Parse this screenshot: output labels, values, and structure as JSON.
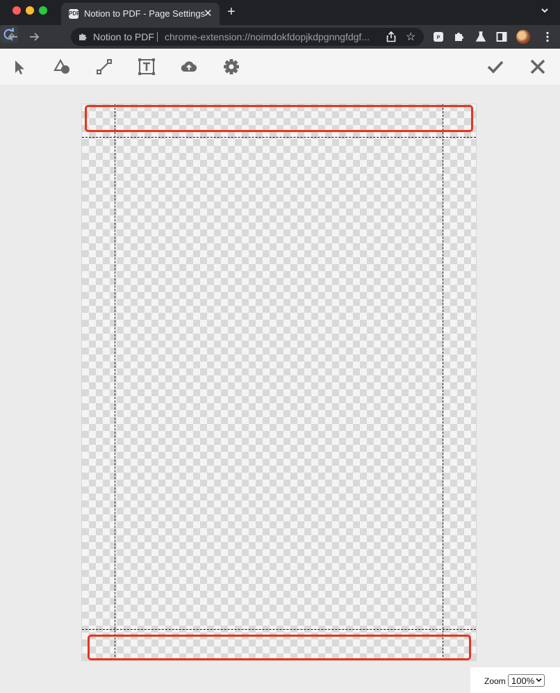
{
  "browser": {
    "tab": {
      "title": "Notion to PDF - Page Settings",
      "favicon": "pdf-favicon-icon",
      "favicon_text": "PDF"
    },
    "omnibox": {
      "extension_name": "Notion to PDF",
      "url": "chrome-extension://noimdokfdopjkdpgnngfdgf..."
    }
  },
  "editor": {
    "tools": [
      {
        "name": "select-tool",
        "icon": "cursor-arrow-icon"
      },
      {
        "name": "shape-tool",
        "icon": "shapes-icon"
      },
      {
        "name": "line-tool",
        "icon": "line-icon"
      },
      {
        "name": "text-tool",
        "icon": "text-box-icon"
      },
      {
        "name": "upload-tool",
        "icon": "cloud-upload-icon"
      },
      {
        "name": "settings-tool",
        "icon": "gear-icon"
      }
    ],
    "actions": [
      {
        "name": "confirm-button",
        "icon": "checkmark-icon"
      },
      {
        "name": "cancel-button",
        "icon": "close-icon"
      }
    ],
    "colors": {
      "highlight": "#e8341c",
      "guide": "#111111",
      "tool_icon": "#666666"
    }
  },
  "zoom": {
    "label": "Zoom",
    "value": "100%"
  }
}
